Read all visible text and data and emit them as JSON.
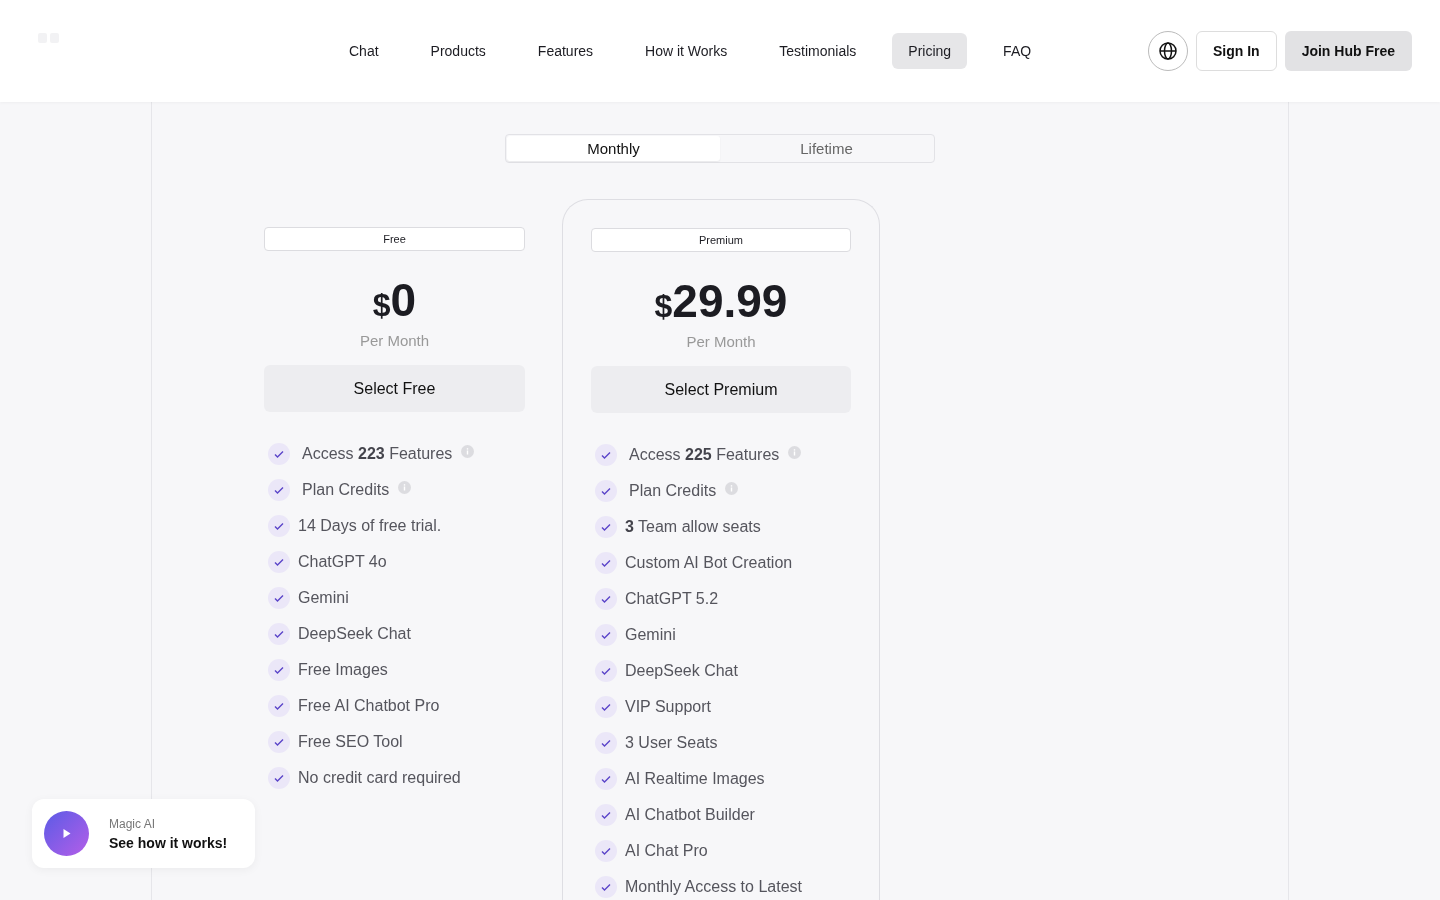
{
  "nav": {
    "items": [
      {
        "label": "Chat",
        "selected": false
      },
      {
        "label": "Products",
        "selected": false
      },
      {
        "label": "Features",
        "selected": false
      },
      {
        "label": "How it Works",
        "selected": false
      },
      {
        "label": "Testimonials",
        "selected": false
      },
      {
        "label": "Pricing",
        "selected": true
      },
      {
        "label": "FAQ",
        "selected": false
      }
    ],
    "sign_in": "Sign In",
    "join": "Join Hub Free"
  },
  "billing_toggle": [
    {
      "label": "Monthly",
      "selected": true
    },
    {
      "label": "Lifetime",
      "selected": false
    }
  ],
  "plans": [
    {
      "badge": "Free",
      "currency": "$",
      "price": "0",
      "period": "Per Month",
      "button": "Select Free",
      "highlighted": false,
      "features": [
        {
          "text": "Access **223** Features",
          "info": true
        },
        {
          "text": "Plan Credits",
          "info": true
        },
        {
          "text": "14 Days of free trial.",
          "info": false
        },
        {
          "text": "ChatGPT 4o",
          "info": false
        },
        {
          "text": "Gemini",
          "info": false
        },
        {
          "text": "DeepSeek Chat",
          "info": false
        },
        {
          "text": "Free Images",
          "info": false
        },
        {
          "text": "Free AI Chatbot Pro",
          "info": false
        },
        {
          "text": "Free SEO Tool",
          "info": false
        },
        {
          "text": "No credit card required",
          "info": false
        }
      ]
    },
    {
      "badge": "Premium",
      "currency": "$",
      "price": "29.99",
      "period": "Per Month",
      "button": "Select Premium",
      "highlighted": true,
      "features": [
        {
          "text": "Access **225** Features",
          "info": true
        },
        {
          "text": "Plan Credits",
          "info": true
        },
        {
          "text": "**3** Team allow seats",
          "info": false
        },
        {
          "text": "Custom AI Bot Creation",
          "info": false
        },
        {
          "text": "ChatGPT 5.2",
          "info": false
        },
        {
          "text": "Gemini",
          "info": false
        },
        {
          "text": "DeepSeek Chat",
          "info": false
        },
        {
          "text": "VIP Support",
          "info": false
        },
        {
          "text": "3 User Seats",
          "info": false
        },
        {
          "text": "AI Realtime Images",
          "info": false
        },
        {
          "text": "AI Chatbot Builder",
          "info": false
        },
        {
          "text": "AI Chat Pro",
          "info": false
        },
        {
          "text": "Monthly Access to Latest",
          "info": false
        }
      ]
    }
  ],
  "promo": {
    "caption": "Magic AI",
    "title": "See how it works!"
  }
}
